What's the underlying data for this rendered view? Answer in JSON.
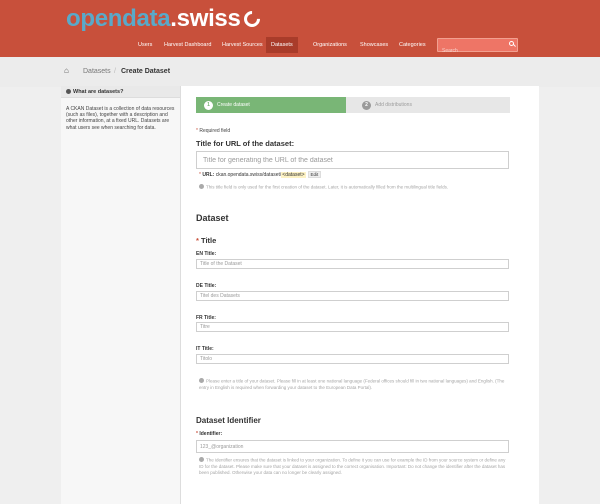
{
  "header": {
    "logo_part1": "opendata",
    "logo_part2": ".swiss",
    "nav": [
      "Users",
      "Harvest Dashboard",
      "Harvest Sources",
      "Datasets",
      "Organizations",
      "Showcases",
      "Categories"
    ],
    "active_nav": "Datasets",
    "search_placeholder": "Search",
    "colors": {
      "header_bg": "#c8503b",
      "active_tab": "#a93c2a",
      "step_active": "#79b676"
    }
  },
  "breadcrumb": {
    "items": [
      "Datasets",
      "Create Dataset"
    ]
  },
  "sidebar": {
    "heading": "What are datasets?",
    "text": "A CKAN Dataset is a collection of data resources (such as files), together with a description and other information, at a fixed URL. Datasets are what users see when searching for data."
  },
  "stepper": {
    "step1": {
      "number": "1",
      "label": "Create dataset"
    },
    "step2": {
      "number": "2",
      "label": "Add distributions"
    }
  },
  "form": {
    "required_note": "Required field",
    "url_title": "Title for URL of the dataset:",
    "url_placeholder": "Title for generating the URL of the dataset",
    "url_label": "URL:",
    "url_value": "ckan.opendata.swiss/dataset/",
    "url_slug": "<dataset>",
    "url_edit": "Edit",
    "url_help": "This title field is only used for the first creation of the dataset. Later, it is automatically filled from the multilingual title fields.",
    "dataset_heading": "Dataset",
    "title_heading": "Title",
    "en_label": "EN Title:",
    "en_placeholder": "Title of the Dataset",
    "de_label": "DE Title:",
    "de_placeholder": "Titel des Datasets",
    "fr_label": "FR Title:",
    "fr_placeholder": "Titre",
    "it_label": "IT Title:",
    "it_placeholder": "Titolo",
    "title_help": "Please enter a title of your dataset. Please fill in at least one national language (Federal offices should fill in two national languages) and English. (The entry in English is required when forwarding your dataset to the European Data Portal).",
    "identifier_heading": "Dataset Identifier",
    "identifier_label": "Identifier:",
    "identifier_placeholder": "123_@organization",
    "identifier_help": "The identifier ensures that the dataset is linked to your organization. To define it you can use for example the ID from your source system or define any ID for the dataset. Please make sure that your dataset is assigned to the correct organisation. Important: Do not change the identifier after the dataset has been published. Otherwise your data can no longer be clearly assigned."
  }
}
